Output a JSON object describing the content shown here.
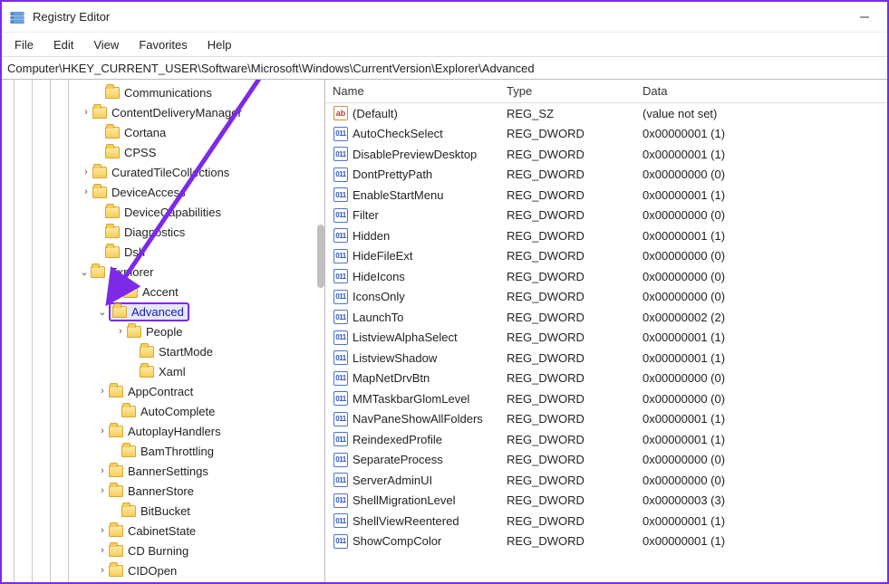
{
  "window": {
    "title": "Registry Editor"
  },
  "menu": {
    "file": "File",
    "edit": "Edit",
    "view": "View",
    "favorites": "Favorites",
    "help": "Help"
  },
  "address": {
    "value": "Computer\\HKEY_CURRENT_USER\\Software\\Microsoft\\Windows\\CurrentVersion\\Explorer\\Advanced"
  },
  "tree": [
    {
      "indent": 100,
      "expander": "",
      "label": "Communications"
    },
    {
      "indent": 86,
      "expander": ">",
      "label": "ContentDeliveryManager"
    },
    {
      "indent": 100,
      "expander": "",
      "label": "Cortana"
    },
    {
      "indent": 100,
      "expander": "",
      "label": "CPSS"
    },
    {
      "indent": 86,
      "expander": ">",
      "label": "CuratedTileCollections"
    },
    {
      "indent": 86,
      "expander": ">",
      "label": "DeviceAccess"
    },
    {
      "indent": 100,
      "expander": "",
      "label": "DeviceCapabilities"
    },
    {
      "indent": 100,
      "expander": "",
      "label": "Diagnostics"
    },
    {
      "indent": 100,
      "expander": "",
      "label": "Dsh"
    },
    {
      "indent": 84,
      "expander": "v",
      "label": "Explorer"
    },
    {
      "indent": 120,
      "expander": "",
      "label": "Accent"
    },
    {
      "indent": 104,
      "expander": "v",
      "label": "Advanced",
      "selected": true
    },
    {
      "indent": 124,
      "expander": ">",
      "label": "People"
    },
    {
      "indent": 138,
      "expander": "",
      "label": "StartMode"
    },
    {
      "indent": 138,
      "expander": "",
      "label": "Xaml"
    },
    {
      "indent": 104,
      "expander": ">",
      "label": "AppContract"
    },
    {
      "indent": 118,
      "expander": "",
      "label": "AutoComplete"
    },
    {
      "indent": 104,
      "expander": ">",
      "label": "AutoplayHandlers"
    },
    {
      "indent": 118,
      "expander": "",
      "label": "BamThrottling"
    },
    {
      "indent": 104,
      "expander": ">",
      "label": "BannerSettings"
    },
    {
      "indent": 104,
      "expander": ">",
      "label": "BannerStore"
    },
    {
      "indent": 118,
      "expander": "",
      "label": "BitBucket"
    },
    {
      "indent": 104,
      "expander": ">",
      "label": "CabinetState"
    },
    {
      "indent": 104,
      "expander": ">",
      "label": "CD Burning"
    },
    {
      "indent": 104,
      "expander": ">",
      "label": "CIDOpen"
    }
  ],
  "columns": {
    "name": "Name",
    "type": "Type",
    "data": "Data"
  },
  "values": [
    {
      "icon": "sz",
      "name": "(Default)",
      "type": "REG_SZ",
      "data": "(value not set)"
    },
    {
      "icon": "dw",
      "name": "AutoCheckSelect",
      "type": "REG_DWORD",
      "data": "0x00000001 (1)"
    },
    {
      "icon": "dw",
      "name": "DisablePreviewDesktop",
      "type": "REG_DWORD",
      "data": "0x00000001 (1)"
    },
    {
      "icon": "dw",
      "name": "DontPrettyPath",
      "type": "REG_DWORD",
      "data": "0x00000000 (0)"
    },
    {
      "icon": "dw",
      "name": "EnableStartMenu",
      "type": "REG_DWORD",
      "data": "0x00000001 (1)"
    },
    {
      "icon": "dw",
      "name": "Filter",
      "type": "REG_DWORD",
      "data": "0x00000000 (0)"
    },
    {
      "icon": "dw",
      "name": "Hidden",
      "type": "REG_DWORD",
      "data": "0x00000001 (1)"
    },
    {
      "icon": "dw",
      "name": "HideFileExt",
      "type": "REG_DWORD",
      "data": "0x00000000 (0)"
    },
    {
      "icon": "dw",
      "name": "HideIcons",
      "type": "REG_DWORD",
      "data": "0x00000000 (0)"
    },
    {
      "icon": "dw",
      "name": "IconsOnly",
      "type": "REG_DWORD",
      "data": "0x00000000 (0)"
    },
    {
      "icon": "dw",
      "name": "LaunchTo",
      "type": "REG_DWORD",
      "data": "0x00000002 (2)"
    },
    {
      "icon": "dw",
      "name": "ListviewAlphaSelect",
      "type": "REG_DWORD",
      "data": "0x00000001 (1)"
    },
    {
      "icon": "dw",
      "name": "ListviewShadow",
      "type": "REG_DWORD",
      "data": "0x00000001 (1)"
    },
    {
      "icon": "dw",
      "name": "MapNetDrvBtn",
      "type": "REG_DWORD",
      "data": "0x00000000 (0)"
    },
    {
      "icon": "dw",
      "name": "MMTaskbarGlomLevel",
      "type": "REG_DWORD",
      "data": "0x00000000 (0)"
    },
    {
      "icon": "dw",
      "name": "NavPaneShowAllFolders",
      "type": "REG_DWORD",
      "data": "0x00000001 (1)"
    },
    {
      "icon": "dw",
      "name": "ReindexedProfile",
      "type": "REG_DWORD",
      "data": "0x00000001 (1)"
    },
    {
      "icon": "dw",
      "name": "SeparateProcess",
      "type": "REG_DWORD",
      "data": "0x00000000 (0)"
    },
    {
      "icon": "dw",
      "name": "ServerAdminUI",
      "type": "REG_DWORD",
      "data": "0x00000000 (0)"
    },
    {
      "icon": "dw",
      "name": "ShellMigrationLevel",
      "type": "REG_DWORD",
      "data": "0x00000003 (3)"
    },
    {
      "icon": "dw",
      "name": "ShellViewReentered",
      "type": "REG_DWORD",
      "data": "0x00000001 (1)"
    },
    {
      "icon": "dw",
      "name": "ShowCompColor",
      "type": "REG_DWORD",
      "data": "0x00000001 (1)"
    }
  ]
}
